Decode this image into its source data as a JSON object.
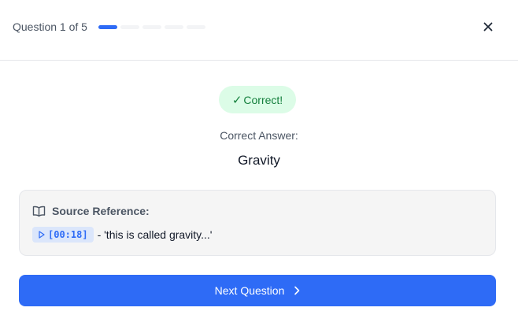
{
  "header": {
    "question_label": "Question 1 of 5",
    "progress": {
      "current": 1,
      "total": 5
    },
    "close_icon": "close-icon"
  },
  "result": {
    "badge_icon": "check-icon",
    "badge_label": "Correct!",
    "answer_label": "Correct Answer:",
    "answer_value": "Gravity"
  },
  "reference": {
    "icon": "book-open-icon",
    "title": "Source Reference:",
    "timestamp_icon": "play-icon",
    "timestamp": "[00:18]",
    "quote": "- 'this is called gravity...'"
  },
  "next_button": {
    "label": "Next Question",
    "icon": "chevron-right-icon"
  },
  "colors": {
    "accent": "#2e6bf6",
    "success_bg": "#dcfce7",
    "success_text": "#15803d",
    "card_bg": "#f5f5f5"
  }
}
